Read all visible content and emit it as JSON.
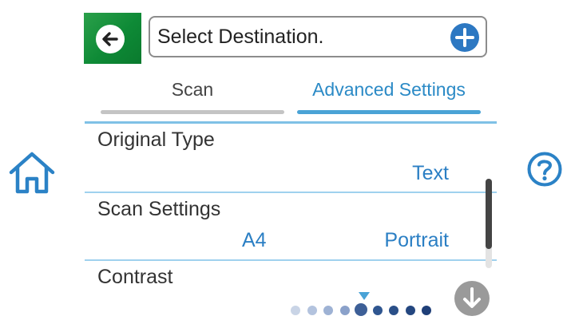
{
  "destination": {
    "placeholder": "Select Destination."
  },
  "tabs": [
    {
      "label": "Scan"
    },
    {
      "label": "Advanced Settings"
    }
  ],
  "settings": [
    {
      "label": "Original Type",
      "value": "Text"
    },
    {
      "label": "Scan Settings",
      "values": [
        "A4",
        "Portrait"
      ]
    },
    {
      "label": "Contrast"
    }
  ],
  "pager": {
    "total": 9,
    "current": 5
  },
  "icons": {
    "back": "back-arrow-icon",
    "add": "plus-icon",
    "home": "home-icon",
    "help": "help-icon",
    "scroll_down": "arrow-down-icon"
  },
  "colors": {
    "back_button": "#1a9440",
    "accent_blue": "#2b7fc4",
    "tab_active_line": "#4aa3d6",
    "tab_inactive_line": "#c4c4c4",
    "separator": "#9fd1ee"
  }
}
